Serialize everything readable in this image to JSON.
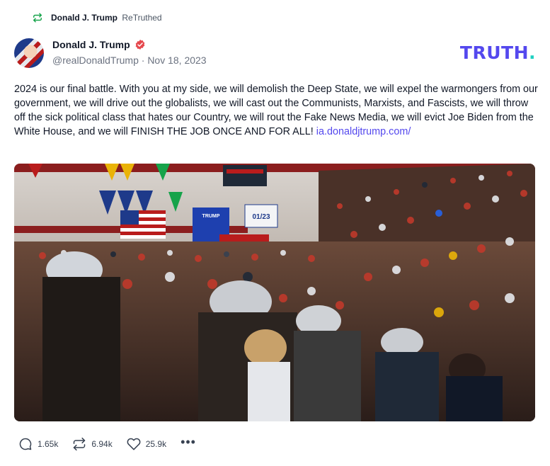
{
  "retruth": {
    "icon": "retruth-icon",
    "name": "Donald J. Trump",
    "label": "ReTruthed"
  },
  "author": {
    "name": "Donald J. Trump",
    "verified_icon": "verified-badge-icon",
    "handle": "@realDonaldTrump",
    "separator": "·",
    "date": "Nov 18, 2023"
  },
  "brand": {
    "logo_text": "TRUTH",
    "logo_dot": ".",
    "color_primary": "#5448ee",
    "color_dot": "#1fd0c1"
  },
  "post": {
    "text": "2024 is our final battle. With you at my side, we will demolish the Deep State, we will expel the warmongers from our government, we will drive out the globalists, we will cast out the Communists, Marxists, and Fascists, we will throw off the sick political class that hates our Country, we will rout the Fake News Media, we will evict Joe Biden from the White House, and we will FINISH THE JOB ONCE AND FOR ALL!",
    "link": "ia.donaldjtrump.com/"
  },
  "media": {
    "sign_text": "TRUMP",
    "banner_text": "01/23"
  },
  "actions": {
    "replies": "1.65k",
    "retruths": "6.94k",
    "likes": "25.9k",
    "more": "•••"
  }
}
